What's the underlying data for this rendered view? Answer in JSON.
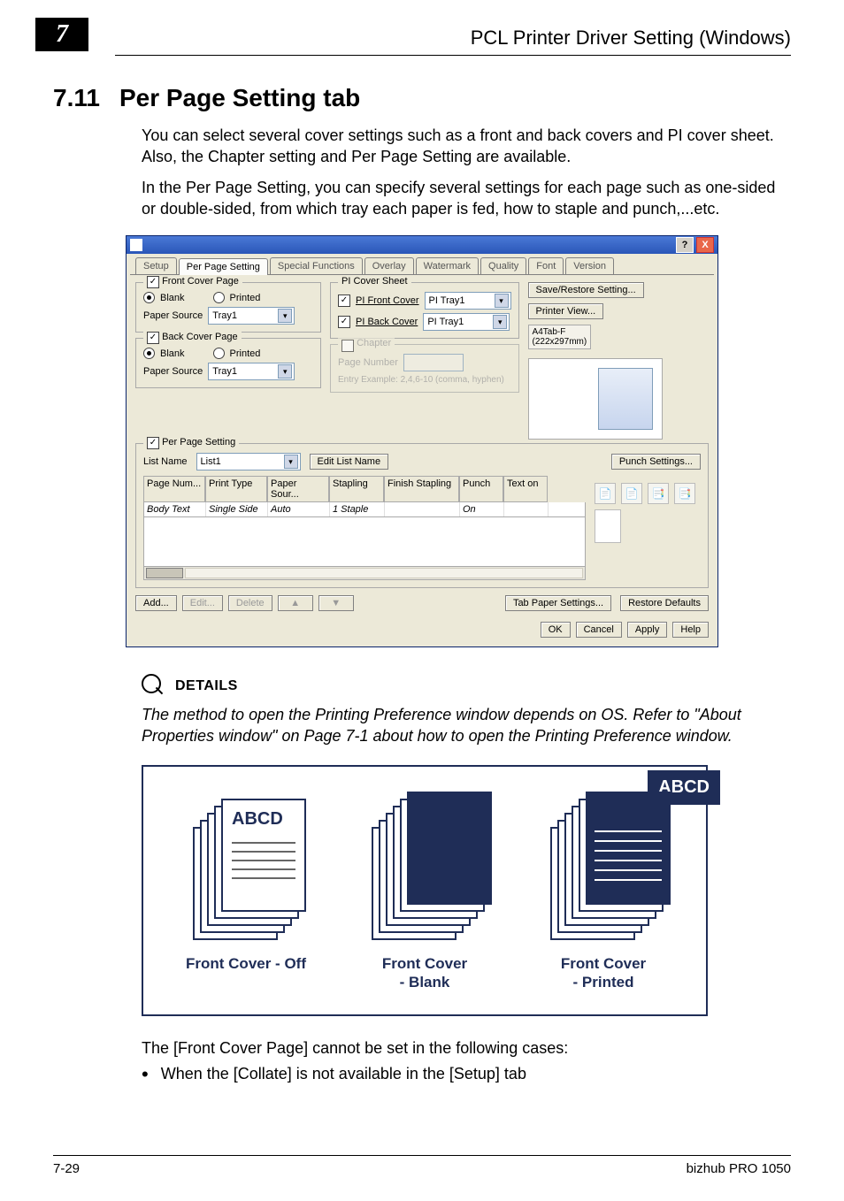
{
  "header": {
    "chapter_marker": "7",
    "running_title": "PCL Printer Driver Setting (Windows)"
  },
  "section": {
    "number": "7.11",
    "title": "Per Page Setting tab"
  },
  "body": {
    "p1": "You can select several cover settings such as a front and back covers and PI cover sheet. Also, the Chapter setting and Per Page Setting are available.",
    "p2": "In the Per Page Setting, you can specify several settings for each page such as one-sided or double-sided, from which tray each paper is fed, how to staple and punch,...etc."
  },
  "dialog": {
    "tabs": [
      "Setup",
      "Per Page Setting",
      "Special Functions",
      "Overlay",
      "Watermark",
      "Quality",
      "Font",
      "Version"
    ],
    "active_tab_index": 1,
    "front_cover": {
      "legend": "Front Cover Page",
      "checked": true,
      "blank": "Blank",
      "printed": "Printed",
      "selected": "blank",
      "paper_source_label": "Paper Source",
      "paper_source_value": "Tray1"
    },
    "back_cover": {
      "legend": "Back Cover Page",
      "checked": true,
      "blank": "Blank",
      "printed": "Printed",
      "selected": "blank",
      "paper_source_label": "Paper Source",
      "paper_source_value": "Tray1"
    },
    "pi_cover": {
      "legend": "PI Cover Sheet",
      "front_label": "PI Front Cover",
      "front_value": "PI Tray1",
      "back_label": "PI Back Cover",
      "back_value": "PI Tray1"
    },
    "chapter": {
      "legend": "Chapter",
      "page_number_label": "Page Number",
      "hint": "Entry Example: 2,4,6-10 (comma, hyphen)"
    },
    "per_page": {
      "legend": "Per Page Setting",
      "list_name_label": "List Name",
      "list_name_value": "List1",
      "edit_list_btn": "Edit List Name",
      "punch_settings_btn": "Punch Settings...",
      "columns": [
        "Page Num...",
        "Print Type",
        "Paper Sour...",
        "Stapling",
        "Finish Stapling",
        "Punch",
        "Text on"
      ],
      "row1": [
        "Body Text",
        "Single Side",
        "Auto",
        "1 Staple",
        "",
        "On",
        ""
      ]
    },
    "right": {
      "save_restore_btn": "Save/Restore Setting...",
      "printer_view_btn": "Printer View...",
      "paper_name": "A4Tab-F",
      "paper_dim": "(222x297mm)"
    },
    "title_btns": {
      "help": "?",
      "close": "X"
    },
    "bottom_left": {
      "add": "Add...",
      "edit": "Edit...",
      "delete": "Delete",
      "up": "▲",
      "down": "▼"
    },
    "bottom_right": {
      "tab_paper": "Tab Paper Settings...",
      "restore": "Restore Defaults"
    },
    "footer": {
      "ok": "OK",
      "cancel": "Cancel",
      "apply": "Apply",
      "help": "Help"
    }
  },
  "details": {
    "label": "DETAILS",
    "text": "The method to open the Printing Preference window depends on OS. Refer to \"About Properties window\" on Page 7-1 about how to open the Printing Preference window."
  },
  "illustration": {
    "abcd": "ABCD",
    "title_text": "ABCD",
    "peek_letter": "A",
    "captions": {
      "off": "Front Cover - Off",
      "blank": "Front Cover\n- Blank",
      "print": "Front Cover\n- Printed"
    }
  },
  "after": {
    "line": "The [Front Cover Page] cannot be set in the following cases:",
    "bullet": "When the [Collate] is not available in the [Setup] tab"
  },
  "footer": {
    "left": "7-29",
    "right": "bizhub PRO 1050"
  }
}
